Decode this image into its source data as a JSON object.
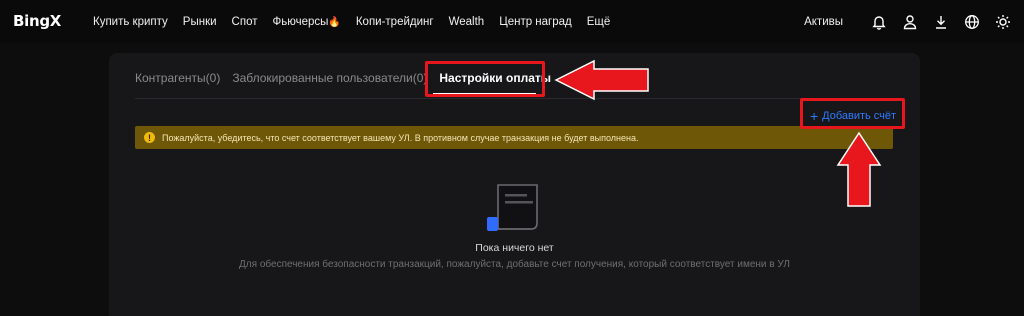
{
  "header": {
    "logo": "BingX",
    "nav": [
      {
        "label": "Купить крипту"
      },
      {
        "label": "Рынки"
      },
      {
        "label": "Спот"
      },
      {
        "label": "Фьючерсы",
        "icon": "fire-icon"
      },
      {
        "label": "Копи-трейдинг"
      },
      {
        "label": "Wealth"
      },
      {
        "label": "Центр наград"
      },
      {
        "label": "Ещё"
      }
    ],
    "assets": "Активы",
    "icons": [
      "bell-icon",
      "user-icon",
      "download-icon",
      "globe-icon",
      "sun-icon"
    ]
  },
  "tabs": [
    {
      "label": "Контрагенты(0)"
    },
    {
      "label": "Заблокированные пользователи(0)"
    },
    {
      "label": "Настройки оплаты",
      "active": true
    }
  ],
  "add_button": {
    "label": "Добавить счёт",
    "icon": "plus-icon"
  },
  "banner": {
    "text": "Пожалуйста, убедитесь, что счет соответствует вашему УЛ. В противном случае транзакция не будет выполнена.",
    "color": "#6f5708",
    "icon": "warning-icon"
  },
  "empty_state": {
    "title": "Пока ничего нет",
    "description": "Для обеспечения безопасности транзакций, пожалуйста, добавьте счет получения, который соответствует имени в УЛ",
    "icon": "document-icon"
  },
  "annotations": {
    "highlight_color": "#e8161d"
  },
  "colors": {
    "accent": "#2f7bff",
    "background": "#0d0d0e",
    "card": "#17171a"
  }
}
